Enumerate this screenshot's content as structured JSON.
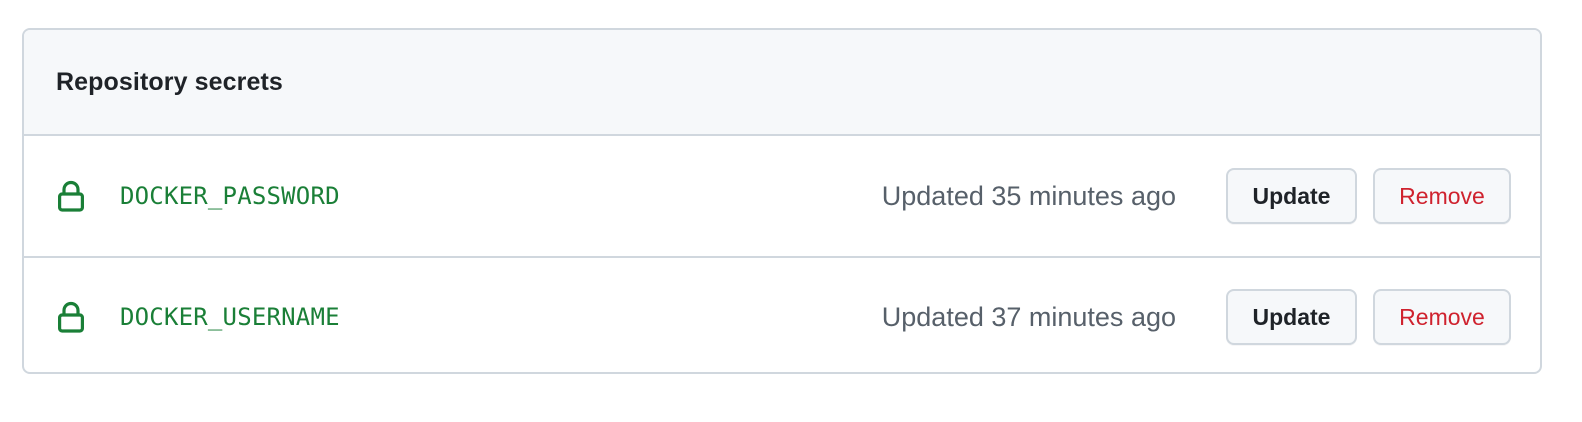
{
  "section": {
    "title": "Repository secrets"
  },
  "secrets": [
    {
      "name": "DOCKER_PASSWORD",
      "updated": "Updated 35 minutes ago",
      "update_label": "Update",
      "remove_label": "Remove"
    },
    {
      "name": "DOCKER_USERNAME",
      "updated": "Updated 37 minutes ago",
      "update_label": "Update",
      "remove_label": "Remove"
    }
  ],
  "icons": {
    "secret": "lock-icon"
  },
  "colors": {
    "secret_name": "#1a7f37",
    "remove_text": "#cf222e",
    "border": "#d0d7de",
    "header_bg": "#f6f8fa",
    "muted_text": "#57606a"
  }
}
